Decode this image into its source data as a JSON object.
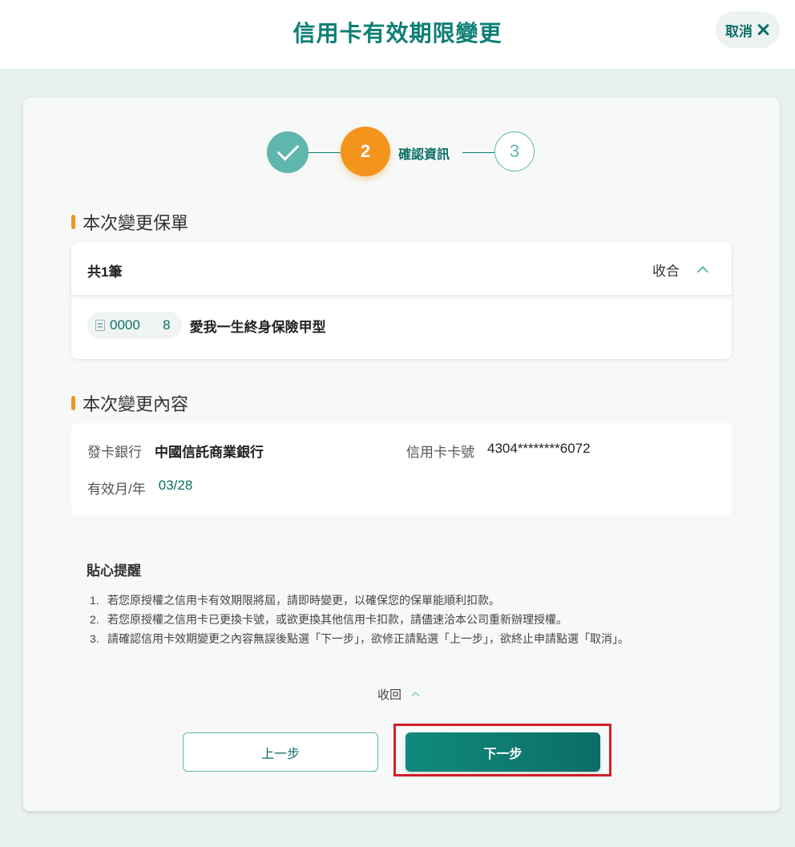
{
  "header": {
    "title": "信用卡有效期限變更",
    "cancel_label": "取消"
  },
  "stepper": {
    "current_step": "2",
    "current_label": "確認資訊",
    "next_step": "3"
  },
  "policy_section": {
    "title": "本次變更保單",
    "count_label": "共1筆",
    "collapse_label": "收合",
    "items": [
      {
        "policy_no": "0000      8",
        "name": "愛我一生終身保險甲型"
      }
    ]
  },
  "change_section": {
    "title": "本次變更內容",
    "bank_label": "發卡銀行",
    "bank_value": "中國信託商業銀行",
    "card_label": "信用卡卡號",
    "card_value": "4304********6072",
    "expiry_label": "有效月/年",
    "expiry_value": "03/28"
  },
  "tips": {
    "title": "貼心提醒",
    "items": [
      {
        "num": "1.",
        "text": "若您原授權之信用卡有效期限將屆，請即時變更，以確保您的保單能順利扣款。"
      },
      {
        "num": "2.",
        "text": "若您原授權之信用卡已更換卡號，或欲更換其他信用卡扣款，請儘速洽本公司重新辦理授權。"
      },
      {
        "num": "3.",
        "text": "請確認信用卡效期變更之內容無誤後點選「下一步」，欲修正請點選「上一步」，欲終止申請點選「取消」。"
      }
    ],
    "collapse_label": "收回"
  },
  "actions": {
    "prev_label": "上一步",
    "next_label": "下一步"
  },
  "colors": {
    "brand": "#0d7f74",
    "accent": "#f3941d",
    "highlight": "#d21f2c"
  }
}
